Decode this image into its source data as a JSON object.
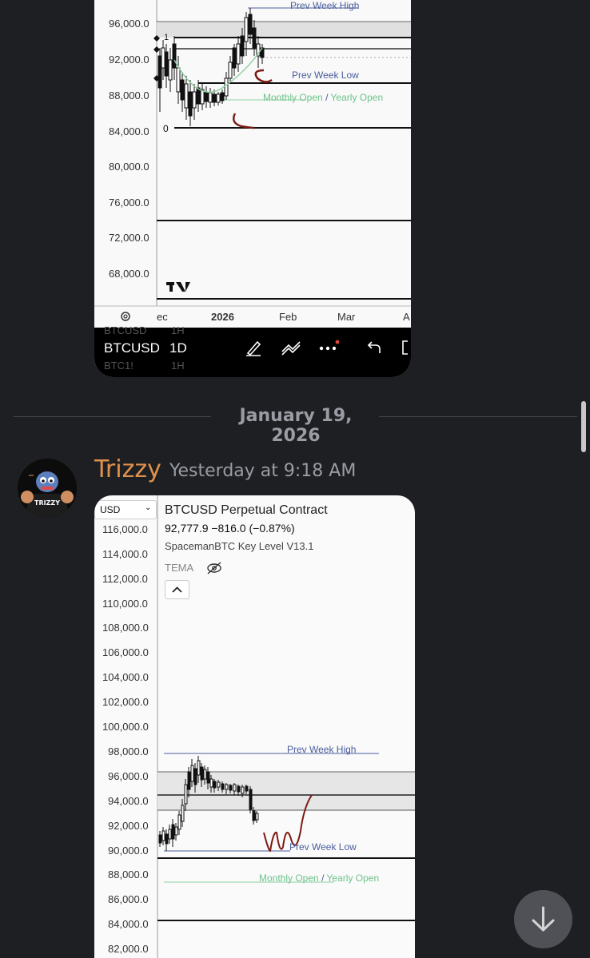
{
  "chart1": {
    "y_labels": [
      "96,000.0",
      "92,000.0",
      "88,000.0",
      "84,000.0",
      "80,000.0",
      "76,000.0",
      "72,000.0",
      "68,000.0"
    ],
    "levels": {
      "prev_week_high": "Prev Week High",
      "prev_week_low": "Prev Week Low",
      "monthly_open": "Monthly Open",
      "separator": "/",
      "yearly_open": "Yearly Open",
      "fib_1": "1",
      "fib_0": "0"
    },
    "x_labels": [
      "ec",
      "2026",
      "Feb",
      "Mar",
      "A"
    ],
    "toolbar": {
      "ghost_row1_ticker": "BTCUSD",
      "ghost_row1_tf": "1H",
      "ticker": "BTCUSD",
      "timeframe": "1D",
      "ghost_row2_ticker": "BTC1!",
      "ghost_row2_tf": "1H"
    },
    "colors": {
      "blue_level": "#4a5d9c",
      "green_level": "#8fd1a0",
      "black_level": "#111111",
      "annotation": "#7b1a12"
    }
  },
  "date_divider": "January 19, 2026",
  "message": {
    "username": "Trizzy",
    "timestamp": "Yesterday at 9:18 AM",
    "avatar_text": "TRIZZY",
    "username_color": "#e0924b"
  },
  "chart2": {
    "currency": "USD",
    "symbol_title": "BTCUSD Perpetual Contract",
    "price_line": "92,777.9  −816.0 (−0.87%)",
    "indicator": "SpacemanBTC Key Level V13.1",
    "indicator2": "TEMA",
    "y_labels": [
      "116,000.0",
      "114,000.0",
      "112,000.0",
      "110,000.0",
      "108,000.0",
      "106,000.0",
      "104,000.0",
      "102,000.0",
      "100,000.0",
      "98,000.0",
      "96,000.0",
      "94,000.0",
      "92,000.0",
      "90,000.0",
      "88,000.0",
      "86,000.0",
      "84,000.0",
      "82,000.0"
    ],
    "levels": {
      "prev_week_high": "Prev Week High",
      "prev_week_low": "Prev Week Low",
      "monthly_open": "Monthly Open",
      "separator": "/",
      "yearly_open": "Yearly Open"
    }
  },
  "icons": {
    "settings": "gear-icon",
    "draw": "pen-icon",
    "indicators": "indicators-icon",
    "more": "more-icon",
    "undo": "undo-icon",
    "expand": "expand-icon",
    "hide": "eye-slash-icon",
    "collapse": "chevron-up-icon",
    "scroll_down": "arrow-down-icon"
  }
}
